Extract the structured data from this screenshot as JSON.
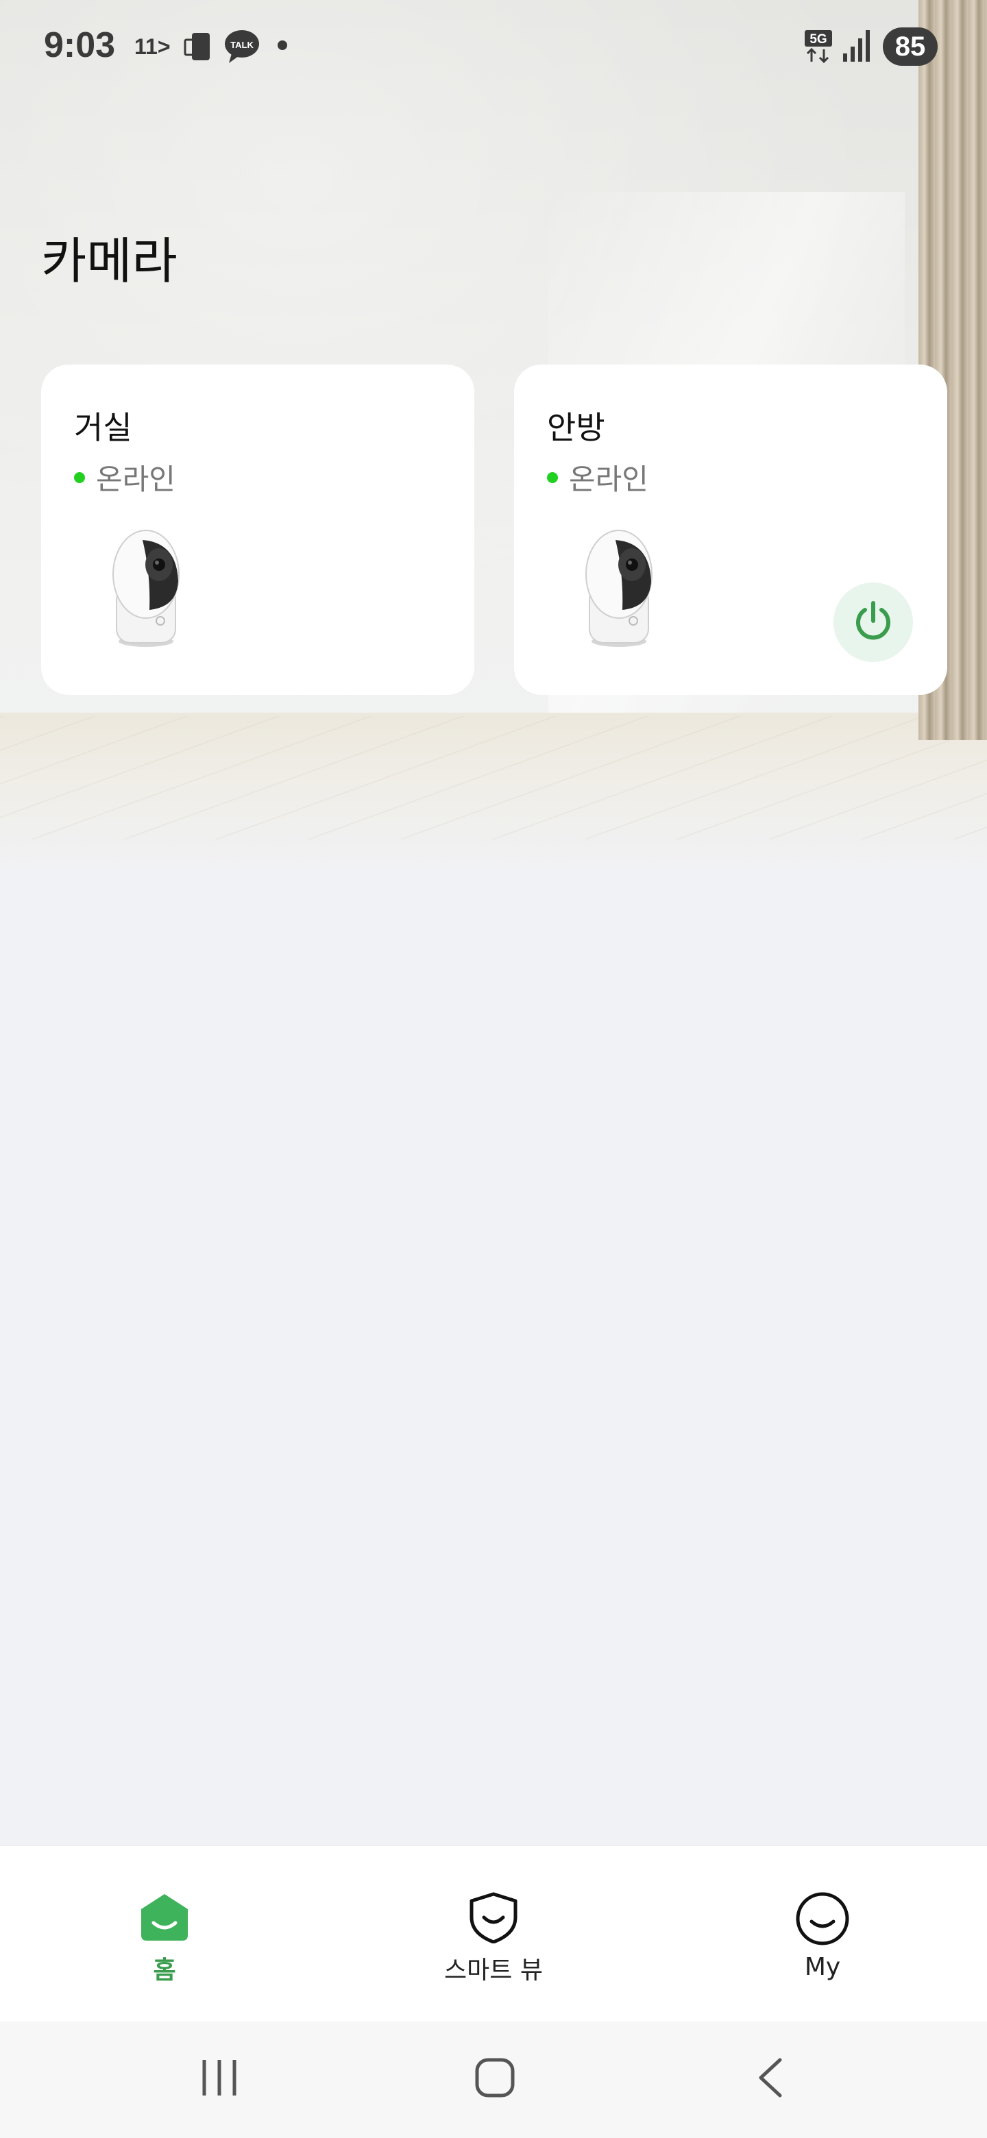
{
  "status_bar": {
    "time": "9:03",
    "carrier_badge": "11>",
    "talk_label": "TALK",
    "network": "5G",
    "battery": "85"
  },
  "page": {
    "title": "카메라"
  },
  "cameras": [
    {
      "name": "거실",
      "status": "온라인",
      "status_color": "#22d022"
    },
    {
      "name": "안방",
      "status": "온라인",
      "status_color": "#22d022",
      "power_icon": "power-icon"
    }
  ],
  "bottom_nav": {
    "active_color": "#3a9d4e",
    "items": [
      {
        "label": "홈",
        "icon": "home-icon",
        "active": true
      },
      {
        "label": "스마트 뷰",
        "icon": "shield-icon",
        "active": false
      },
      {
        "label": "My",
        "icon": "smile-icon",
        "active": false
      }
    ]
  },
  "system_nav": {
    "icons": [
      "recent-apps-icon",
      "home-button-icon",
      "back-icon"
    ]
  }
}
